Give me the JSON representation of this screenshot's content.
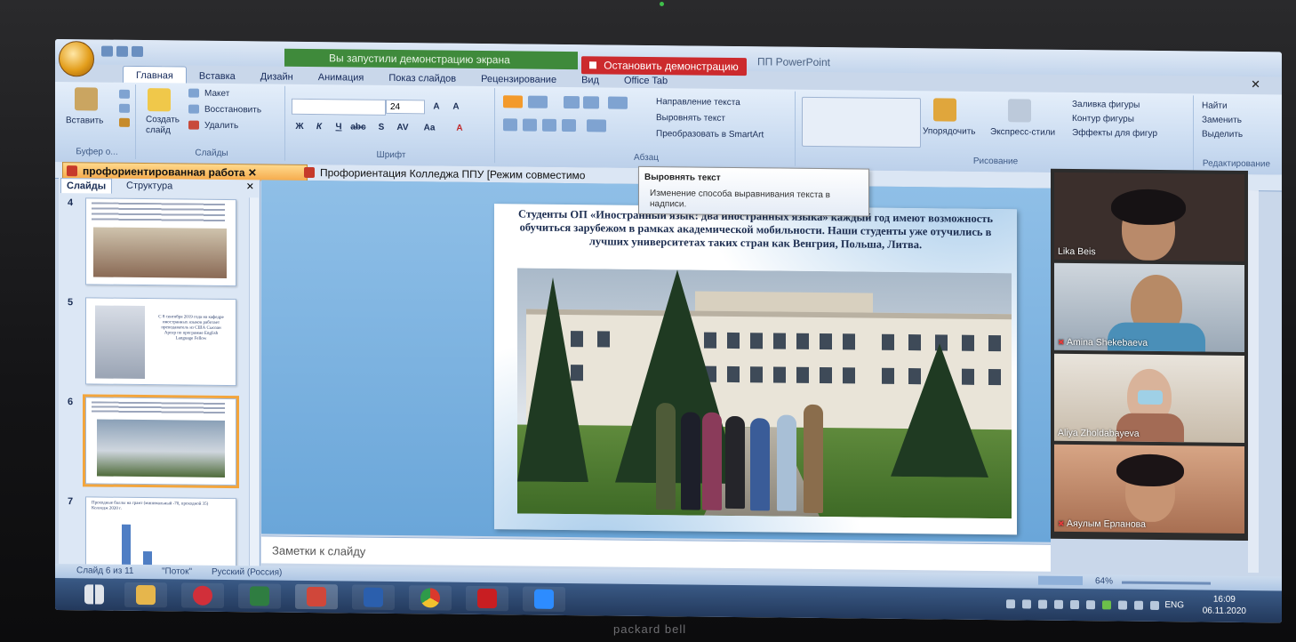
{
  "notification": {
    "screen_share_notice": "Вы запустили демонстрацию экрана",
    "stop_share_label": "Остановить демонстрацию",
    "window_title_suffix": "ПП PowerPoint"
  },
  "ribbon": {
    "tabs": [
      "Главная",
      "Вставка",
      "Дизайн",
      "Анимация",
      "Показ слайдов",
      "Рецензирование",
      "Вид",
      "Office Tab"
    ],
    "active_tab": "Главная",
    "clipboard": {
      "paste_label": "Вставить",
      "group_label": "Буфер о..."
    },
    "slides": {
      "create_label_1": "Создать",
      "create_label_2": "слайд",
      "layout_label": "Макет",
      "reset_label": "Восстановить",
      "delete_label": "Удалить",
      "group_label": "Слайды"
    },
    "font": {
      "size_value": "24",
      "group_label": "Шрифт"
    },
    "paragraph": {
      "text_direction_label": "Направление текста",
      "align_text_label": "Выровнять текст",
      "smartart_label": "Преобразовать в SmartArt",
      "group_label": "Абзац"
    },
    "drawing": {
      "arrange_label": "Упорядочить",
      "quick_styles_label": "Экспресс-стили",
      "shape_fill_label": "Заливка фигуры",
      "shape_outline_label": "Контур фигуры",
      "shape_effects_label": "Эффекты для фигур",
      "group_label": "Рисование"
    },
    "editing": {
      "find_label": "Найти",
      "replace_label": "Заменить",
      "select_label": "Выделить",
      "group_label": "Редактирование"
    }
  },
  "tooltip": {
    "title": "Выровнять текст",
    "description": "Изменение способа выравнивания текста в надписи."
  },
  "document_tabs": [
    {
      "label": "профориентированная работа"
    },
    {
      "label": "Профориентация Колледжа ППУ [Режим совместимо"
    }
  ],
  "slide_panel": {
    "tab_slides": "Слайды",
    "tab_outline": "Структура",
    "thumbnails": [
      {
        "number": "4"
      },
      {
        "number": "5",
        "text": "С 8 сентября 2019 года на кафедре иностранных языков работает преподаватель из США Сьюзан Арсер по программе English Language Fellow"
      },
      {
        "number": "6"
      },
      {
        "number": "7",
        "text": "Проходные баллы на грант (минимальный -70, проходной 35) Колледж 2020 г."
      }
    ]
  },
  "slide": {
    "caption": "Студенты ОП «Иностранный язык: два иностранных языка» каждый год имеют возможность обучиться зарубежом в рамках академической мобильности. Наши студенты уже отучились в лучших университетах таких стран как Венгрия, Польша, Литва."
  },
  "notes": {
    "placeholder": "Заметки к слайду"
  },
  "status": {
    "slide_counter": "Слайд 6 из 11",
    "theme": "\"Поток\"",
    "language": "Русский (Россия)",
    "zoom": "64%"
  },
  "video_participants": [
    {
      "name": "Lika Beis",
      "muted": false
    },
    {
      "name": "Amina Shekebaeva",
      "muted": true
    },
    {
      "name": "Aliya Zholdabayeva",
      "muted": false
    },
    {
      "name": "Аяулым Ерланова",
      "muted": true
    }
  ],
  "taskbar": {
    "language": "ENG",
    "time": "16:09",
    "date": "06.11.2020",
    "apps": [
      "windows-start",
      "file-explorer",
      "power",
      "excel",
      "powerpoint",
      "word",
      "chrome",
      "acrobat",
      "zoom"
    ]
  },
  "device": {
    "brand": "packard bell"
  },
  "colors": {
    "stop_share_red": "#cc2a2d",
    "share_green": "#3f8a3b",
    "ribbon_blue": "#c8daf0",
    "selected_thumb_orange": "#f3a53c"
  }
}
